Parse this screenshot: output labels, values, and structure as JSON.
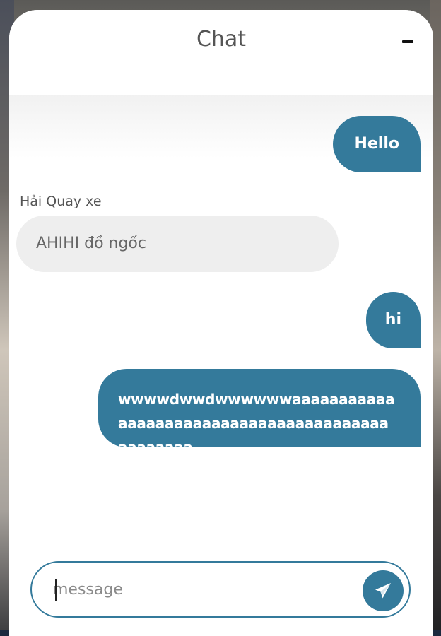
{
  "chat": {
    "title": "Chat",
    "minimize_label": "–"
  },
  "messages": [
    {
      "direction": "outgoing",
      "text": "Hello"
    },
    {
      "direction": "incoming",
      "sender": "Hải Quay xe",
      "text": "AHIHI đồ ngốc"
    },
    {
      "direction": "outgoing",
      "text": "hi"
    },
    {
      "direction": "outgoing",
      "text": "wwwwdwwdwwwwwwaaaaaaaaaaaaaaaaaaaaaaaaaaaaaaaaaaaaaaaaaaaaaaaa"
    }
  ],
  "composer": {
    "placeholder": "message",
    "value": "",
    "send_icon": "paper-plane-icon"
  },
  "colors": {
    "accent": "#347a9b",
    "incoming_bubble": "#eeeeee",
    "panel": "#ffffff"
  }
}
